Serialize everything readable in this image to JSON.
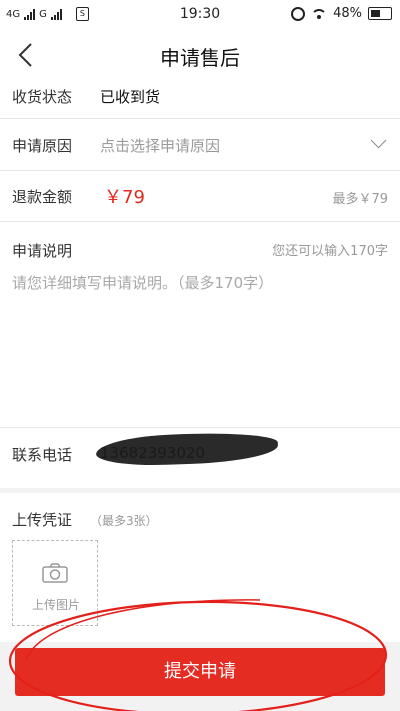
{
  "status_bar": {
    "network": "4G",
    "network2": "G",
    "sim_glyph": "S",
    "time": "19:30",
    "battery": "48%"
  },
  "nav": {
    "title": "申请售后",
    "back_icon": "chevron-left-icon"
  },
  "form": {
    "receipt_status": {
      "label": "收货状态",
      "value": "已收到货"
    },
    "reason": {
      "label": "申请原因",
      "placeholder": "点击选择申请原因"
    },
    "refund": {
      "label": "退款金额",
      "amount": "￥79",
      "max": "最多￥79"
    },
    "description": {
      "label": "申请说明",
      "remaining": "您还可以输入170字",
      "placeholder": "请您详细填写申请说明。（最多170字）"
    },
    "phone": {
      "label": "联系电话",
      "value": "13682393020"
    }
  },
  "upload": {
    "title": "上传凭证",
    "note": "（最多3张）",
    "button_label": "上传图片"
  },
  "submit": {
    "label": "提交申请"
  },
  "colors": {
    "accent": "#e52c23",
    "price": "#e4291f",
    "annotation": "#e3201b"
  }
}
